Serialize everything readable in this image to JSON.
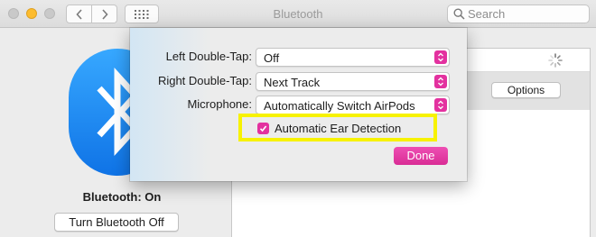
{
  "window": {
    "title": "Bluetooth",
    "search_placeholder": "Search"
  },
  "icons": {
    "back": "chevron-left",
    "forward": "chevron-right",
    "grid": "grid",
    "search": "magnifier",
    "bluetooth": "bluetooth-logo",
    "spinner": "loading-spinner",
    "check": "checkmark",
    "stepper": "up-down-chevrons"
  },
  "colors": {
    "accent": "#e3319f",
    "bluetooth_blue": "#1a8cf5",
    "highlight": "#f7f200"
  },
  "main": {
    "status": "Bluetooth: On",
    "turn_off_label": "Turn Bluetooth Off",
    "options_label": "Options"
  },
  "sheet": {
    "left_double_tap": {
      "label": "Left Double-Tap:",
      "value": "Off"
    },
    "right_double_tap": {
      "label": "Right Double-Tap:",
      "value": "Next Track"
    },
    "microphone": {
      "label": "Microphone:",
      "value": "Automatically Switch AirPods"
    },
    "ear_detection": {
      "label": "Automatic Ear Detection",
      "checked": true
    },
    "done_label": "Done"
  }
}
